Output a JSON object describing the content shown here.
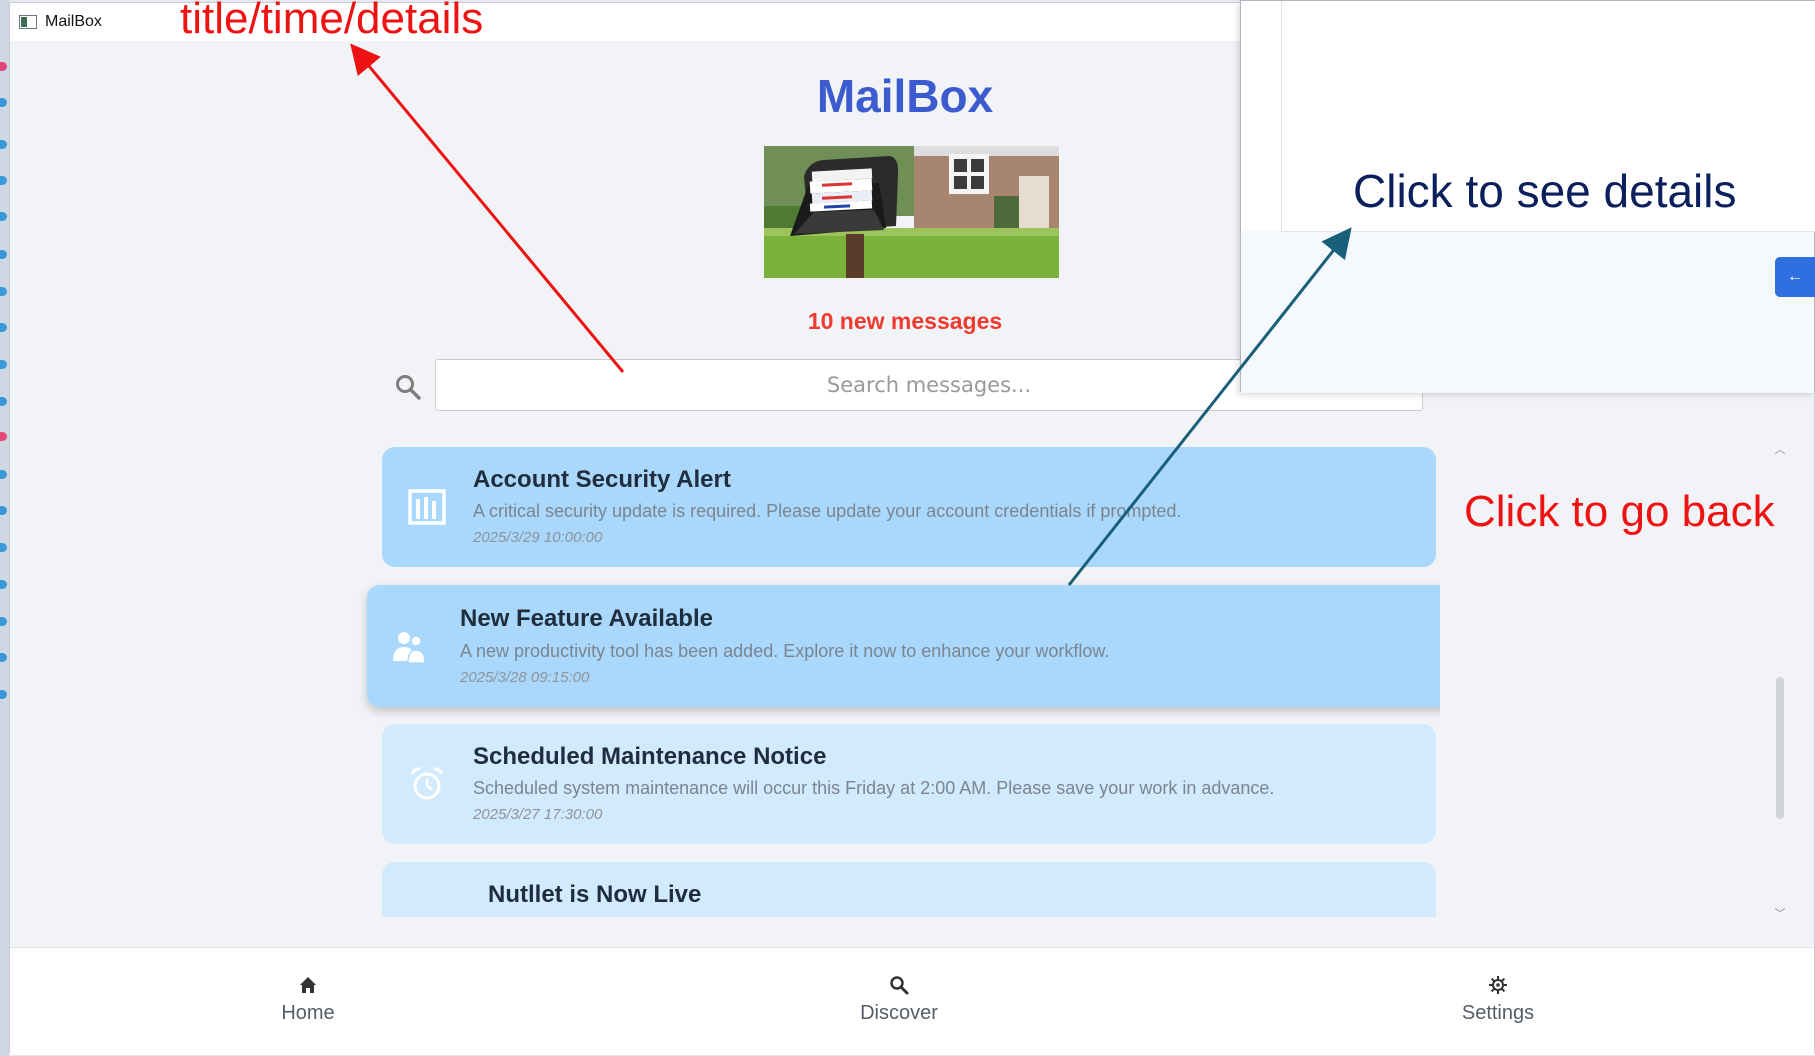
{
  "window": {
    "title": "MailBox"
  },
  "app": {
    "title": "MailBox",
    "new_messages": "10 new messages"
  },
  "search": {
    "placeholder": "Search messages..."
  },
  "messages": [
    {
      "icon": "bar-chart-icon",
      "title": "Account Security Alert",
      "body": "A critical security update is required. Please update your account credentials if prompted.",
      "time": "2025/3/29 10:00:00",
      "state": "unread"
    },
    {
      "icon": "users-icon",
      "title": "New Feature Available",
      "body": "A new productivity tool has been added. Explore it now to enhance your workflow.",
      "time": "2025/3/28 09:15:00",
      "state": "unread-hover"
    },
    {
      "icon": "alarm-clock-icon",
      "title": "Scheduled Maintenance Notice",
      "body": "Scheduled system maintenance will occur this Friday at 2:00 AM. Please save your work in advance.",
      "time": "2025/3/27 17:30:00",
      "state": "read"
    },
    {
      "icon": "",
      "title": "Nutllet is Now Live",
      "body": "",
      "time": "",
      "state": "read"
    }
  ],
  "nav": {
    "items": [
      {
        "label": "Home",
        "icon": "home-icon"
      },
      {
        "label": "Discover",
        "icon": "search-icon"
      },
      {
        "label": "Settings",
        "icon": "gear-icon"
      }
    ]
  },
  "detail_window": {
    "back_label": "←",
    "accent": "#2f6fe0"
  },
  "annotations": {
    "title_time_details": "title/time/details",
    "click_to_see_details": "Click to see details",
    "click_to_go_back": "Click to go back"
  },
  "colors": {
    "title": "#3b5bcf",
    "new_count": "#f03a2f",
    "card_unread": "#a9d8fc",
    "card_read": "#d2eafd",
    "annotation_red": "#ee1313",
    "annotation_blue": "#0a1f5c",
    "arrow_blue": "#1a5f7a"
  }
}
